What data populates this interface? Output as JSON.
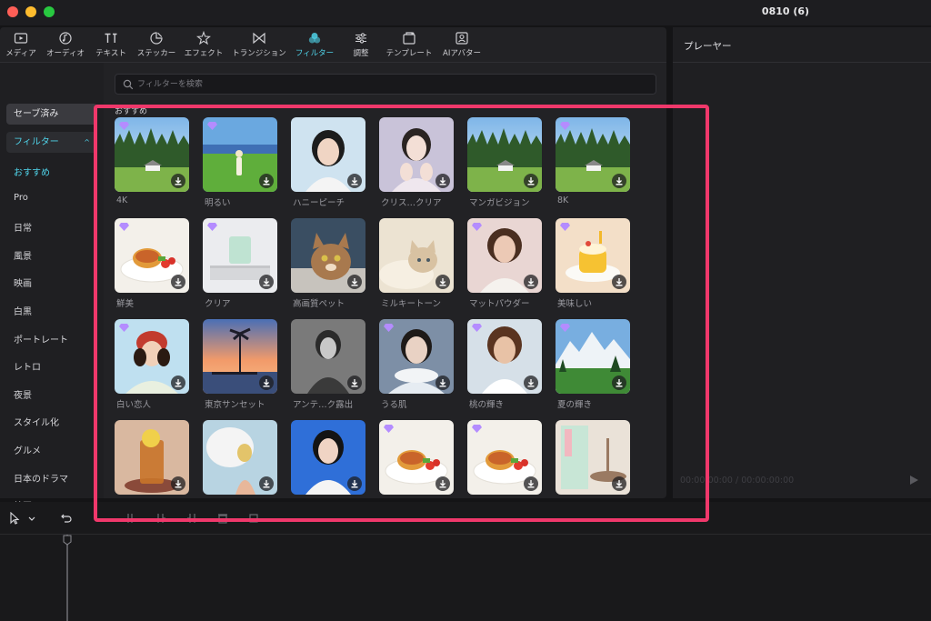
{
  "window": {
    "title": "0810 (6)"
  },
  "toolbar": {
    "items": [
      {
        "label": "メディア",
        "icon": "media-icon"
      },
      {
        "label": "オーディオ",
        "icon": "audio-icon"
      },
      {
        "label": "テキスト",
        "icon": "text-icon"
      },
      {
        "label": "ステッカー",
        "icon": "sticker-icon"
      },
      {
        "label": "エフェクト",
        "icon": "effect-icon"
      },
      {
        "label": "トランジション",
        "icon": "transition-icon"
      },
      {
        "label": "フィルター",
        "icon": "filter-icon",
        "active": true
      },
      {
        "label": "調整",
        "icon": "adjust-icon"
      },
      {
        "label": "テンプレート",
        "icon": "template-icon"
      },
      {
        "label": "AIアバター",
        "icon": "ai-avatar-icon"
      }
    ]
  },
  "sidebar": {
    "saved_label": "セーブ済み",
    "filter_label": "フィルター",
    "categories": [
      "おすすめ",
      "Pro",
      "日常",
      "風景",
      "映画",
      "白黒",
      "ポートレート",
      "レトロ",
      "夜景",
      "スタイル化",
      "グルメ",
      "日本のドラマ",
      "絵画"
    ]
  },
  "search": {
    "placeholder": "フィルターを検索"
  },
  "section": {
    "title": "おすすめ"
  },
  "filters": [
    {
      "label": "4K",
      "thumb": "landscape",
      "pro": true
    },
    {
      "label": "明るい",
      "thumb": "meadow",
      "pro": true
    },
    {
      "label": "ハニーピーチ",
      "thumb": "portrait-a",
      "pro": false
    },
    {
      "label": "クリス…クリア",
      "thumb": "portrait-b",
      "pro": false
    },
    {
      "label": "マンガビジョン",
      "thumb": "landscape",
      "pro": false
    },
    {
      "label": "8K",
      "thumb": "landscape",
      "pro": true
    },
    {
      "label": "鮮美",
      "thumb": "food",
      "pro": true
    },
    {
      "label": "クリア",
      "thumb": "candle",
      "pro": true
    },
    {
      "label": "高画質ペット",
      "thumb": "cat-a",
      "pro": false
    },
    {
      "label": "ミルキートーン",
      "thumb": "cat-b",
      "pro": false
    },
    {
      "label": "マットパウダー",
      "thumb": "portrait-c",
      "pro": true
    },
    {
      "label": "美味しい",
      "thumb": "cake",
      "pro": true
    },
    {
      "label": "白い恋人",
      "thumb": "portrait-d",
      "pro": true
    },
    {
      "label": "東京サンセット",
      "thumb": "sunset",
      "pro": false
    },
    {
      "label": "アンテ…ク露出",
      "thumb": "portrait-bw",
      "pro": false
    },
    {
      "label": "うる肌",
      "thumb": "portrait-e",
      "pro": true
    },
    {
      "label": "桃の輝き",
      "thumb": "portrait-f",
      "pro": true
    },
    {
      "label": "夏の輝き",
      "thumb": "mountain",
      "pro": true
    },
    {
      "label": "",
      "thumb": "drink",
      "pro": false
    },
    {
      "label": "",
      "thumb": "woman-sky",
      "pro": false
    },
    {
      "label": "",
      "thumb": "portrait-blue",
      "pro": false
    },
    {
      "label": "",
      "thumb": "food",
      "pro": true
    },
    {
      "label": "",
      "thumb": "food",
      "pro": true
    },
    {
      "label": "",
      "thumb": "interior",
      "pro": false
    }
  ],
  "player": {
    "title": "プレーヤー",
    "timecode": "00:00:00:00 / 00:00:00:00"
  },
  "colors": {
    "accent": "#4fd2e8",
    "highlight": "#f0386b",
    "pro_badge": "#b48cff"
  }
}
